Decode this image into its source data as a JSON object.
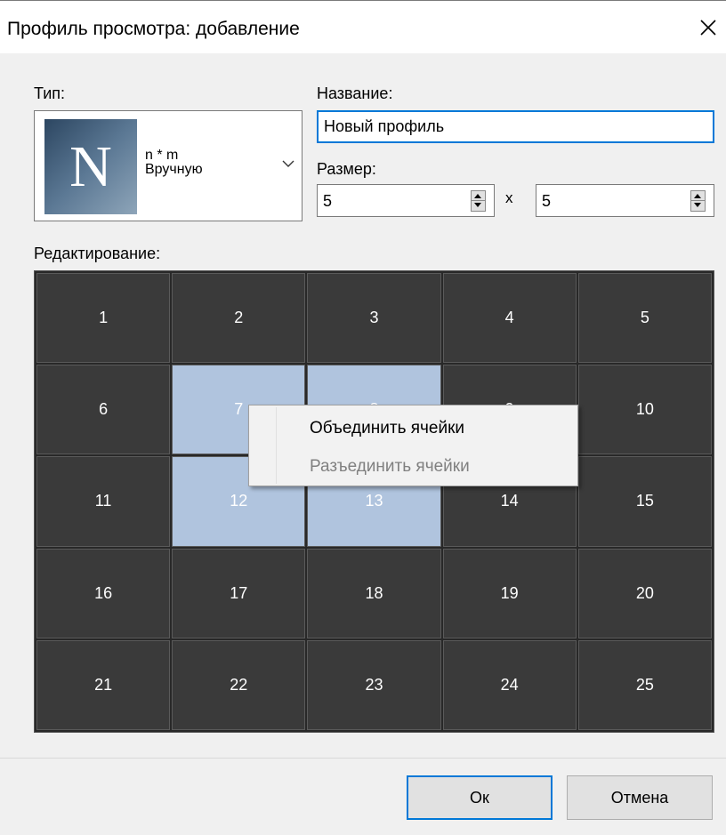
{
  "window": {
    "title": "Профиль просмотра: добавление",
    "close_label": "×"
  },
  "type_section": {
    "label": "Тип:",
    "icon_letter": "N",
    "line1": "n * m",
    "line2": "Вручную"
  },
  "name_section": {
    "label": "Название:",
    "value": "Новый профиль"
  },
  "size_section": {
    "label": "Размер:",
    "rows": "5",
    "separator": "x",
    "cols": "5"
  },
  "edit_section": {
    "label": "Редактирование:"
  },
  "grid": {
    "rows": 5,
    "cols": 5,
    "cells": [
      "1",
      "2",
      "3",
      "4",
      "5",
      "6",
      "7",
      "8",
      "9",
      "10",
      "11",
      "12",
      "13",
      "14",
      "15",
      "16",
      "17",
      "18",
      "19",
      "20",
      "21",
      "22",
      "23",
      "24",
      "25"
    ],
    "selected": [
      7,
      8,
      12,
      13
    ],
    "cell_color": "#3a3a3a",
    "selected_color": "#b0c4de"
  },
  "context_menu": {
    "items": [
      {
        "label": "Объединить ячейки",
        "enabled": true
      },
      {
        "label": "Разъединить ячейки",
        "enabled": false
      }
    ]
  },
  "buttons": {
    "ok": "Ок",
    "cancel": "Отмена"
  },
  "colors": {
    "accent": "#0078d7"
  }
}
